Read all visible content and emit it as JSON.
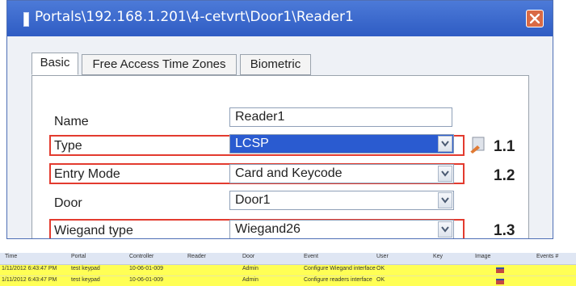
{
  "window": {
    "title": "Portals\\192.168.1.201\\4-cetvrt\\Door1\\Reader1",
    "close_label": "close"
  },
  "tabs": [
    {
      "label": "Basic",
      "active": true
    },
    {
      "label": "Free Access Time Zones",
      "active": false
    },
    {
      "label": "Biometric",
      "active": false
    }
  ],
  "form": {
    "name": {
      "label": "Name",
      "value": "Reader1"
    },
    "type": {
      "label": "Type",
      "value": "LCSP",
      "annotation": "1.1"
    },
    "entry_mode": {
      "label": "Entry Mode",
      "value": "Card and Keycode",
      "annotation": "1.2"
    },
    "door": {
      "label": "Door",
      "value": "Door1"
    },
    "wiegand": {
      "label": "Wiegand type",
      "value": "Wiegand26",
      "annotation": "1.3"
    }
  },
  "grid": {
    "columns": [
      "Time",
      "Portal",
      "Controller",
      "Reader",
      "Door",
      "Event",
      "User",
      "Key",
      "Image",
      "Events #"
    ],
    "rows": [
      {
        "time": "1/11/2012 6:43:47 PM",
        "portal": "test keypad",
        "controller": "10-06-01-009",
        "reader": "",
        "door": "Admin",
        "event": "Configure Wiegand interface",
        "user": "OK",
        "key": "",
        "events": ""
      },
      {
        "time": "1/11/2012 6:43:47 PM",
        "portal": "test keypad",
        "controller": "10-06-01-009",
        "reader": "",
        "door": "Admin",
        "event": "Configure readers interface",
        "user": "OK",
        "key": "",
        "events": ""
      }
    ]
  }
}
